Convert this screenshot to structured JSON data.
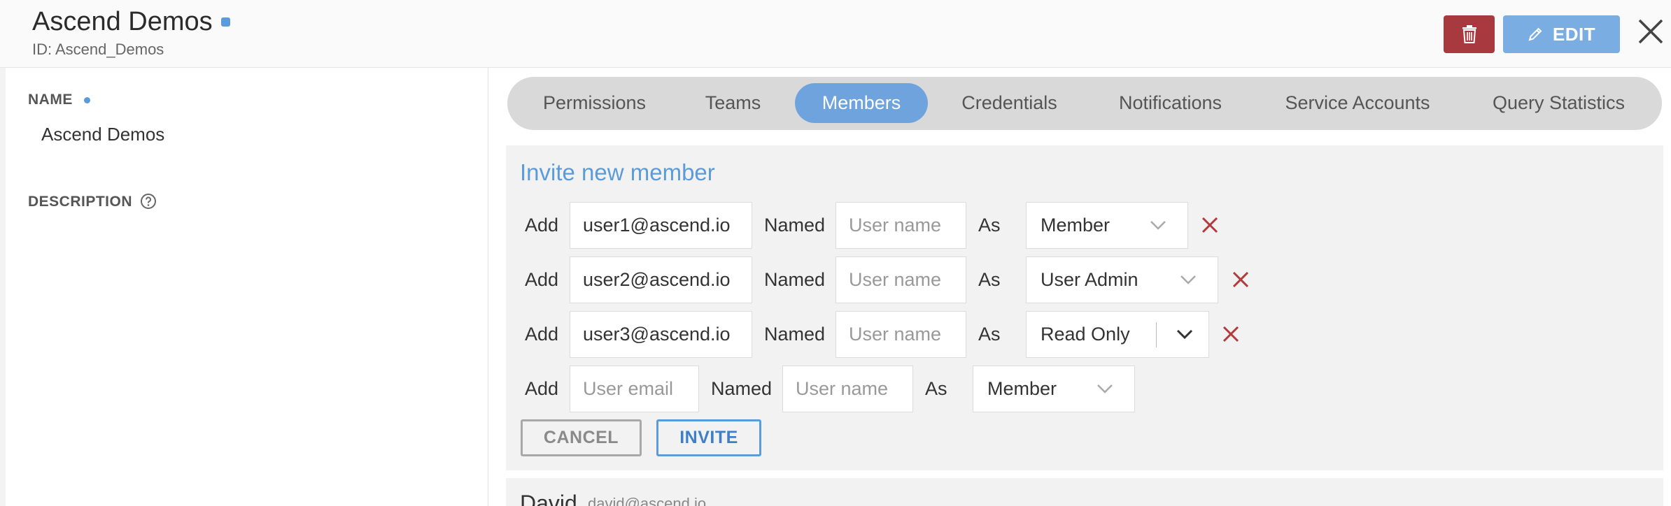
{
  "header": {
    "title": "Ascend Demos",
    "subtitle": "ID: Ascend_Demos",
    "edit_label": "EDIT",
    "delete_icon": "trash-icon",
    "edit_icon": "pencil-icon",
    "close_icon": "close-icon",
    "colors": {
      "delete": "#a83a3f",
      "edit": "#7aaee2",
      "accent": "#5b9bd9"
    }
  },
  "details": {
    "name_label": "NAME",
    "name_value": "Ascend Demos",
    "description_label": "DESCRIPTION",
    "help_icon": "question-circle-icon"
  },
  "tabs": [
    {
      "label": "Permissions",
      "active": false
    },
    {
      "label": "Teams",
      "active": false
    },
    {
      "label": "Members",
      "active": true
    },
    {
      "label": "Credentials",
      "active": false
    },
    {
      "label": "Notifications",
      "active": false
    },
    {
      "label": "Service Accounts",
      "active": false
    },
    {
      "label": "Query Statistics",
      "active": false
    }
  ],
  "invite": {
    "title": "Invite new member",
    "add_label": "Add",
    "named_label": "Named",
    "as_label": "As",
    "email_placeholder": "User email",
    "name_placeholder": "User name",
    "rows": [
      {
        "email": "user1@ascend.io",
        "name": "",
        "role": "Member",
        "removable": true
      },
      {
        "email": "user2@ascend.io",
        "name": "",
        "role": "User Admin",
        "removable": true
      },
      {
        "email": "user3@ascend.io",
        "name": "",
        "role": "Read Only",
        "removable": true
      },
      {
        "email": "",
        "name": "",
        "role": "Member",
        "removable": false
      }
    ],
    "cancel_label": "CANCEL",
    "invite_label": "INVITE"
  },
  "members": [
    {
      "name": "David",
      "email": "david@ascend.io"
    }
  ]
}
